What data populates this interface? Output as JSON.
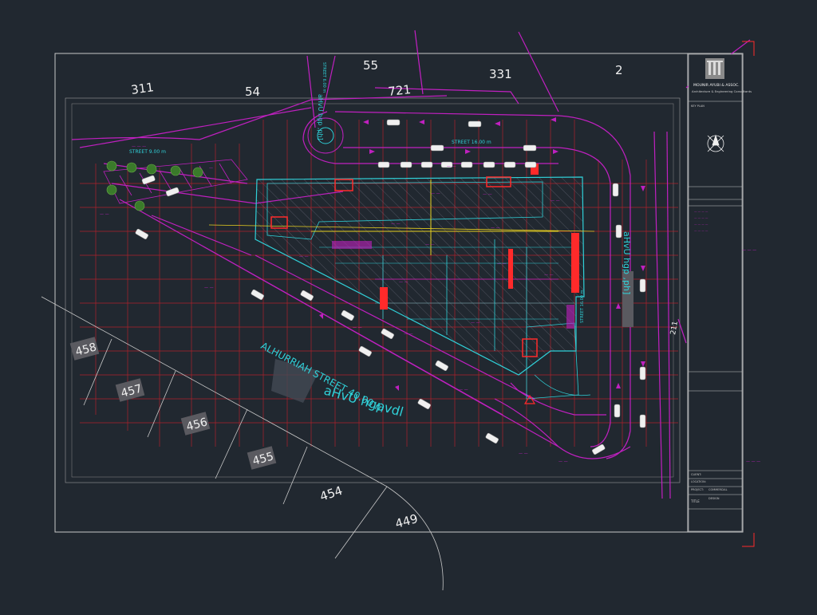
{
  "colors": {
    "background": "#212830",
    "frame": "#c8c8c8",
    "grid": "#c8202a",
    "magenta": "#c020c0",
    "cyan": "#30d0d8",
    "yellow": "#e8d020",
    "white": "#f0f0f0",
    "red": "#ff2a2a"
  },
  "parcel_numbers": {
    "p311": "311",
    "p54": "54",
    "p55": "55",
    "p721": "721",
    "p331": "331",
    "p2": "2",
    "p211": "211",
    "p454": "454",
    "p449": "449"
  },
  "parcel_tags": {
    "p458": "458",
    "p457": "457",
    "p456": "456",
    "p455": "455"
  },
  "street_labels": {
    "street_9m": "STREET 9.00 m",
    "street_16m": "STREET 16.00 m",
    "alhurriah": "ALHURRIAH STREET 40.00 m",
    "alhurriah_arabic": "aHvU hgpvdl",
    "right_arabic": "aHvU hgp ,ph]",
    "right_street": "STREET 16.00 m",
    "top_street": "STREET 6.00 m"
  },
  "title_block": {
    "firm_name": "MOUNIR AYUBI & ASSOC.",
    "firm_subtitle": "Architecture & Engineering Consultants",
    "key_plan_label": "KEY PLAN",
    "client_label": "CLIENT:",
    "location_label": "LOCATION:",
    "project_label": "PROJECT:",
    "title_label": "TITLE",
    "project_value": "COMMERCIAL",
    "title_value": "DESIGN"
  },
  "icons": {
    "logo": "building-logo-icon",
    "north_arrow": "north-arrow-icon",
    "warning": "warning-triangle-icon"
  }
}
